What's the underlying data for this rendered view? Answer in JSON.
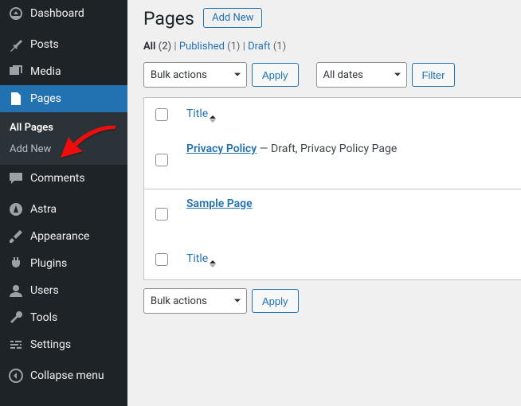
{
  "sidebar": {
    "items": [
      {
        "label": "Dashboard",
        "key": "dashboard"
      },
      {
        "label": "Posts",
        "key": "posts"
      },
      {
        "label": "Media",
        "key": "media"
      },
      {
        "label": "Pages",
        "key": "pages"
      },
      {
        "label": "Comments",
        "key": "comments"
      },
      {
        "label": "Astra",
        "key": "astra"
      },
      {
        "label": "Appearance",
        "key": "appearance"
      },
      {
        "label": "Plugins",
        "key": "plugins"
      },
      {
        "label": "Users",
        "key": "users"
      },
      {
        "label": "Tools",
        "key": "tools"
      },
      {
        "label": "Settings",
        "key": "settings"
      },
      {
        "label": "Collapse menu",
        "key": "collapse"
      }
    ],
    "submenu": [
      {
        "label": "All Pages"
      },
      {
        "label": "Add New"
      }
    ]
  },
  "header": {
    "title": "Pages",
    "add_new": "Add New"
  },
  "views": {
    "all_label": "All",
    "all_count": "(2)",
    "sep": " | ",
    "published_label": "Published",
    "published_count": "(1)",
    "draft_label": "Draft",
    "draft_count": "(1)"
  },
  "controls": {
    "bulk": "Bulk actions",
    "apply": "Apply",
    "dates": "All dates",
    "filter": "Filter"
  },
  "table": {
    "title_col": "Title",
    "rows": [
      {
        "title": "Privacy Policy",
        "suffix": " — Draft, Privacy Policy Page"
      },
      {
        "title": "Sample Page",
        "suffix": ""
      }
    ]
  },
  "colors": {
    "accent": "#2271b1"
  }
}
